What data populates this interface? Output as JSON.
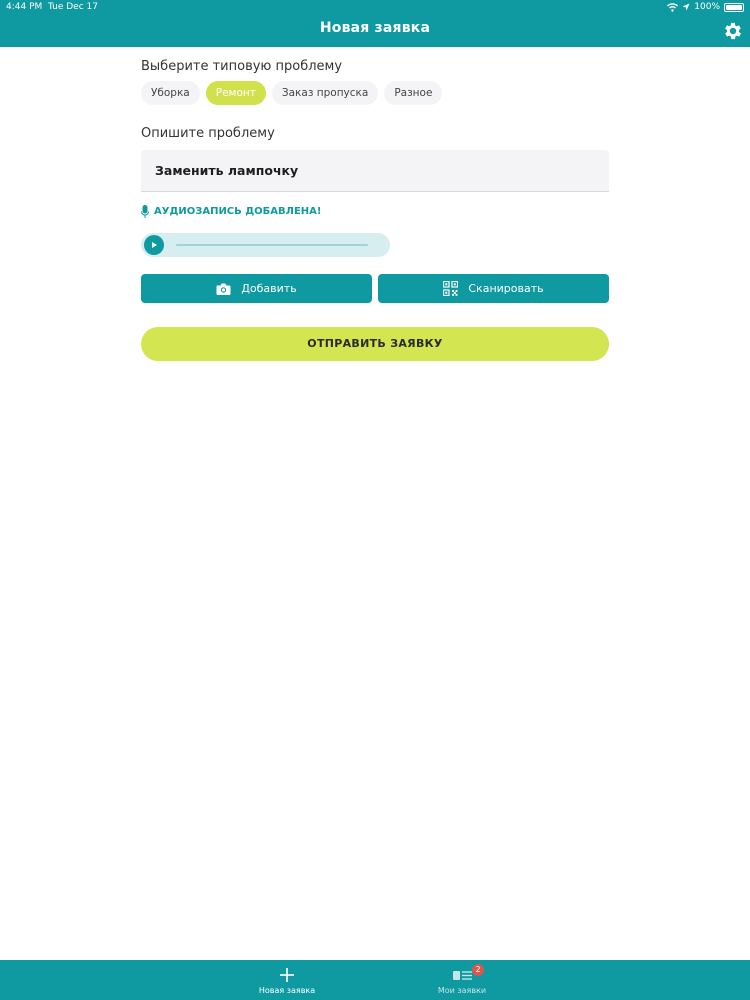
{
  "status_bar": {
    "time": "4:44 PM",
    "date": "Tue Dec 17",
    "battery": "100%"
  },
  "header": {
    "title": "Новая заявка"
  },
  "form": {
    "type_label": "Выберите типовую проблему",
    "chips": [
      {
        "label": "Уборка",
        "selected": false
      },
      {
        "label": "Ремонт",
        "selected": true
      },
      {
        "label": "Заказ пропуска",
        "selected": false
      },
      {
        "label": "Разное",
        "selected": false
      }
    ],
    "description_label": "Опишите проблему",
    "description_value": "Заменить лампочку",
    "audio_note": "АУДИОЗАПИСЬ ДОБАВЛЕНА!",
    "add_button": "Добавить",
    "scan_button": "Сканировать",
    "submit_button": "ОТПРАВИТЬ ЗАЯВКУ"
  },
  "tabbar": {
    "tabs": [
      {
        "label": "Новая заявка",
        "icon": "plus-icon",
        "active": true
      },
      {
        "label": "Мои заявки",
        "icon": "list-icon",
        "badge": "2",
        "active": false
      }
    ]
  },
  "colors": {
    "primary": "#0f9aa1",
    "accent": "#d3e551",
    "badge": "#d9574f"
  }
}
